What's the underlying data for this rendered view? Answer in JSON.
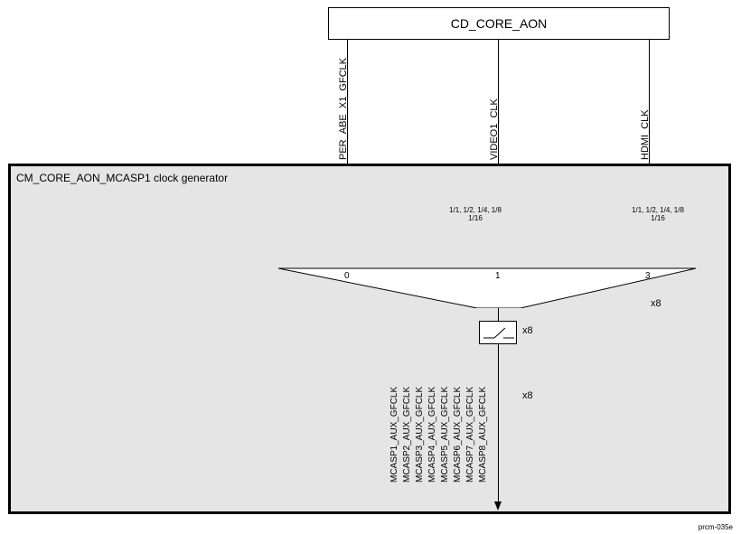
{
  "top_block": {
    "title": "CD_CORE_AON"
  },
  "main_block": {
    "title": "CM_CORE_AON_MCASP1 clock generator"
  },
  "input_clocks": {
    "in0": "PER_ABE_X1_GFCLK",
    "in1": "VIDEO1_CLK",
    "in3": "HDMI_CLK"
  },
  "dividers": {
    "d1": {
      "line1": "1/1, 1/2, 1/4, 1/8",
      "line2": "1/16"
    },
    "d3": {
      "line1": "1/1, 1/2, 1/4, 1/8",
      "line2": "1/16"
    }
  },
  "mux": {
    "port0": "0",
    "port1": "1",
    "port3": "3",
    "mult_label": "x8"
  },
  "gate": {
    "mult_label": "x8"
  },
  "output": {
    "mult_label": "x8",
    "signals": [
      "MCASP1_AUX_GFCLK",
      "MCASP2_AUX_GFCLK",
      "MCASP3_AUX_GFCLK",
      "MCASP4_AUX_GFCLK",
      "MCASP5_AUX_GFCLK",
      "MCASP6_AUX_GFCLK",
      "MCASP7_AUX_GFCLK",
      "MCASP8_AUX_GFCLK"
    ]
  },
  "footer_id": "prcm-035e"
}
